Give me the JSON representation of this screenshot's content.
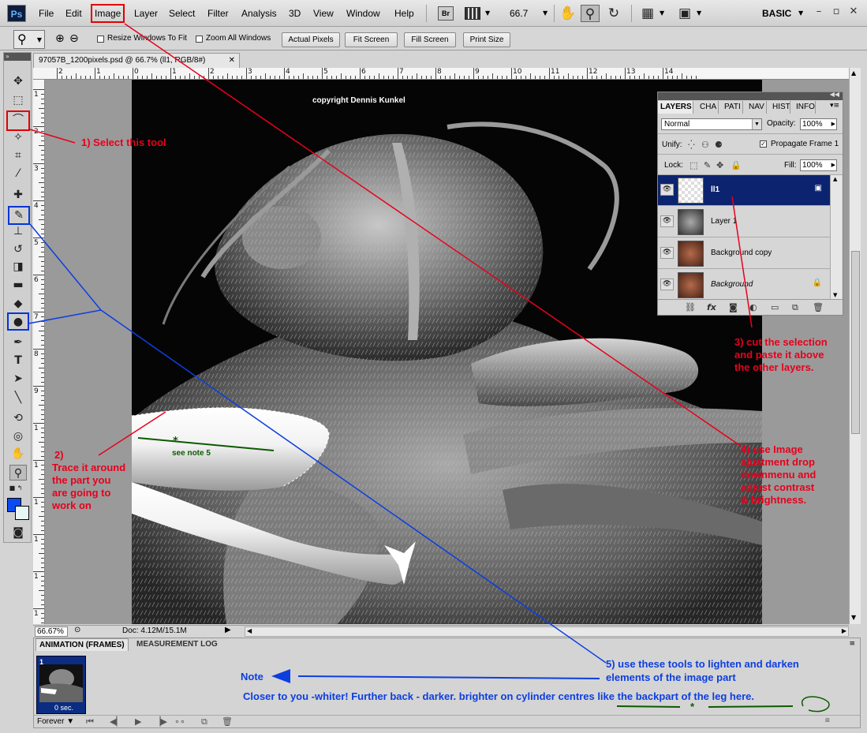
{
  "app": {
    "logo": "Ps"
  },
  "menu": [
    "File",
    "Edit",
    "Image",
    "Layer",
    "Select",
    "Filter",
    "Analysis",
    "3D",
    "View",
    "Window",
    "Help"
  ],
  "menubar": {
    "bridge_label": "Br",
    "zoom": "66.7",
    "workspace": "BASIC"
  },
  "options": {
    "resize_windows_label": "Resize Windows To Fit",
    "zoom_all_label": "Zoom All Windows",
    "buttons": [
      "Actual Pixels",
      "Fit Screen",
      "Fill Screen",
      "Print Size"
    ]
  },
  "document": {
    "tab_title": "97057B_1200pixels.psd @ 66.7% (ll1, RGB/8#)",
    "copyright": "copyright Dennis Kunkel",
    "ruler_top": [
      "2",
      "1",
      "0",
      "1",
      "2",
      "3",
      "4",
      "5",
      "6",
      "7",
      "8",
      "9",
      "10",
      "11",
      "12",
      "13",
      "14"
    ],
    "ruler_left": [
      "1",
      "2",
      "3",
      "4",
      "5",
      "6",
      "7",
      "8",
      "9",
      "1",
      "1",
      "1",
      "1",
      "1",
      "1"
    ]
  },
  "status": {
    "zoom": "66.67%",
    "doc_size": "Doc: 4.12M/15.1M"
  },
  "animation_panel": {
    "tab_active": "ANIMATION (FRAMES)",
    "tab_inactive": "MEASUREMENT LOG",
    "frame_number": "1",
    "frame_delay": "0 sec.",
    "loop": "Forever"
  },
  "layers_panel": {
    "tabs": [
      "LAYERS",
      "CHA",
      "PATI",
      "NAV",
      "HIST",
      "INFO"
    ],
    "blend_mode": "Normal",
    "opacity_label": "Opacity:",
    "opacity": "100%",
    "unify_label": "Unify:",
    "propagate_label": "Propagate Frame 1",
    "lock_label": "Lock:",
    "fill_label": "Fill:",
    "fill": "100%",
    "layers": [
      {
        "name": "ll1",
        "selected": true
      },
      {
        "name": "Layer 1",
        "selected": false
      },
      {
        "name": "Background copy",
        "selected": false
      },
      {
        "name": "Background",
        "selected": false
      }
    ]
  },
  "annotations": {
    "step1": "1) Select this tool",
    "step2": [
      "2)",
      "Trace it around",
      "the part you",
      "are going to",
      "work on"
    ],
    "step3": [
      "3) cut the selection",
      "and paste it above",
      "the other layers."
    ],
    "step4": [
      "4) use Image",
      "ajustment drop",
      "downmenu and",
      "adjust contrast",
      "& brightness."
    ],
    "step5": [
      "5) use these tools to lighten and darken",
      "elements of the image part"
    ],
    "note_label": "Note",
    "note_text": "Closer to you -whiter! Further back - darker. brighter on cylinder centres like the backpart of the leg here.",
    "see_note": "see note 5",
    "star": "*"
  },
  "colors": {
    "annotation_red": "#e8001c",
    "annotation_blue": "#0c3ee0",
    "annotation_green": "#0c5a00",
    "selected_layer": "#0c2470"
  }
}
